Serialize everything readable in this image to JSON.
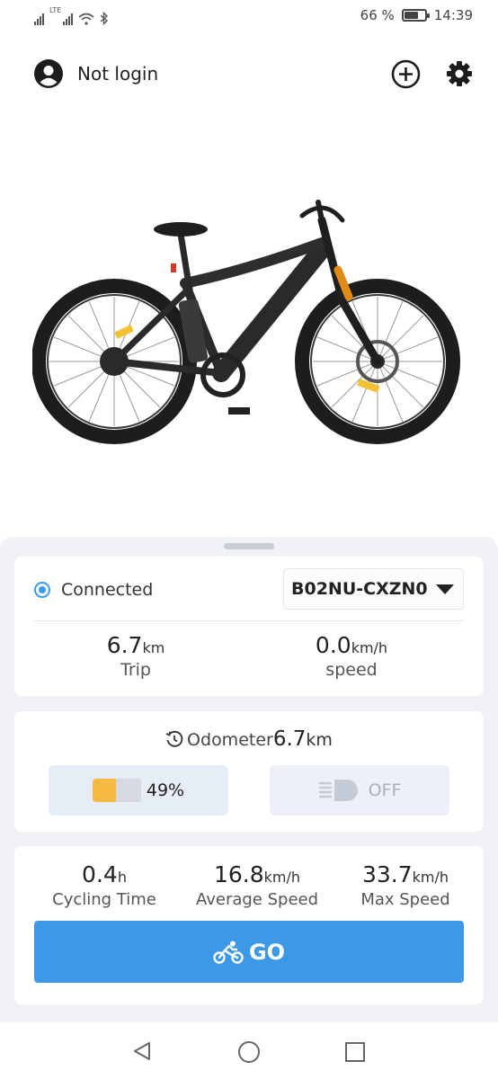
{
  "status_bar": {
    "network": "LTE",
    "battery_percent": "66 %",
    "battery_level": 0.66,
    "time": "14:39"
  },
  "header": {
    "login_label": "Not login",
    "icons": [
      "user-avatar-icon",
      "add-circle-icon",
      "gear-icon"
    ]
  },
  "connection": {
    "status": "Connected",
    "device": "B02NU-CXZN0"
  },
  "trip_stats": {
    "trip_value": "6.7",
    "trip_unit": "km",
    "trip_label": "Trip",
    "speed_value": "0.0",
    "speed_unit": "km/h",
    "speed_label": "speed"
  },
  "odometer": {
    "label": "Odometer",
    "value": "6.7",
    "unit": "km"
  },
  "battery": {
    "percent": "49%",
    "level": 0.49,
    "color": "#f5b944"
  },
  "light": {
    "state": "OFF"
  },
  "ride_stats": {
    "cycling_time_value": "0.4",
    "cycling_time_unit": "h",
    "cycling_time_label": "Cycling Time",
    "avg_speed_value": "16.8",
    "avg_speed_unit": "km/h",
    "avg_speed_label": "Average Speed",
    "max_speed_value": "33.7",
    "max_speed_unit": "km/h",
    "max_speed_label": "Max Speed"
  },
  "go_button": {
    "label": "GO",
    "color": "#3d99e6"
  },
  "navbar": {
    "icons": [
      "back-icon",
      "home-icon",
      "recent-apps-icon"
    ]
  }
}
